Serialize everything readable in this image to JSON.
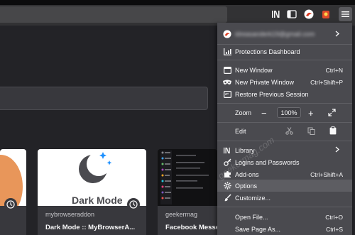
{
  "account": {
    "email": "idreasanderk19@gmail.com"
  },
  "menu": {
    "protections": "Protections Dashboard",
    "new_window": "New Window",
    "new_window_sc": "Ctrl+N",
    "new_private": "New Private Window",
    "new_private_sc": "Ctrl+Shift+P",
    "restore": "Restore Previous Session",
    "zoom_label": "Zoom",
    "zoom_minus": "−",
    "zoom_value": "100%",
    "zoom_plus": "+",
    "edit_label": "Edit",
    "library": "Library",
    "logins": "Logins and Passwords",
    "addons": "Add-ons",
    "addons_sc": "Ctrl+Shift+A",
    "options": "Options",
    "customize": "Customize...",
    "open_file": "Open File...",
    "open_file_sc": "Ctrl+O",
    "save_page": "Save Page As...",
    "save_page_sc": "Ctrl+S"
  },
  "cards": [
    {
      "source": "",
      "title": ""
    },
    {
      "source": "mybrowseraddon",
      "title": "Dark Mode :: MyBrowserA...",
      "thumb_text": "Dark Mode"
    },
    {
      "source": "geekermag",
      "title": "Facebook Messe"
    }
  ],
  "watermark": "geekermag.com",
  "colors": {
    "menu_bg": "#4a4a4f",
    "toolbar": "#323234",
    "highlight": "#5d5d62",
    "star_blue": "#1e90ff"
  }
}
